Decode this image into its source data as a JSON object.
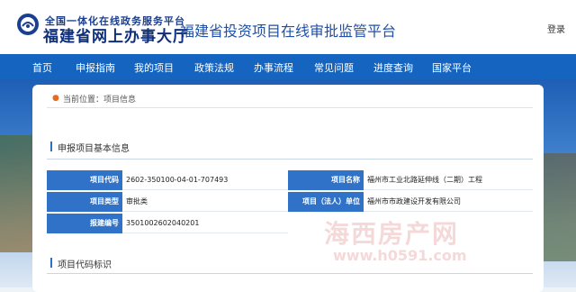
{
  "header": {
    "portal_small": "全国一体化在线政务服务平台",
    "portal_big": "福建省网上办事大厅",
    "site_title": "福建省投资项目在线审批监管平台",
    "login": "登录"
  },
  "nav": {
    "items": [
      {
        "label": "首页"
      },
      {
        "label": "申报指南"
      },
      {
        "label": "我的项目"
      },
      {
        "label": "政策法规"
      },
      {
        "label": "办事流程"
      },
      {
        "label": "常见问题"
      },
      {
        "label": "进度查询"
      },
      {
        "label": "国家平台"
      }
    ]
  },
  "breadcrumb": {
    "text": "当前位置：项目信息"
  },
  "section1": {
    "title": "申报项目基本信息",
    "fields": [
      {
        "label": "项目代码",
        "value": "2602-350100-04-01-707493"
      },
      {
        "label": "项目名称",
        "value": "福州市工业北路延伸线（二期）工程"
      },
      {
        "label": "项目类型",
        "value": "审批类"
      },
      {
        "label": "项目（法人）单位",
        "value": "福州市市政建设开发有限公司"
      },
      {
        "label": "报建编号",
        "value": "3501002602040201"
      }
    ]
  },
  "section2": {
    "title": "项目代码标识"
  },
  "watermark": {
    "text": "海西房产网",
    "url": "www.h0591.com"
  },
  "colors": {
    "nav_bg": "#1565c0",
    "label_bg": "#2f72c8",
    "title_blue": "#1f4fa6"
  }
}
